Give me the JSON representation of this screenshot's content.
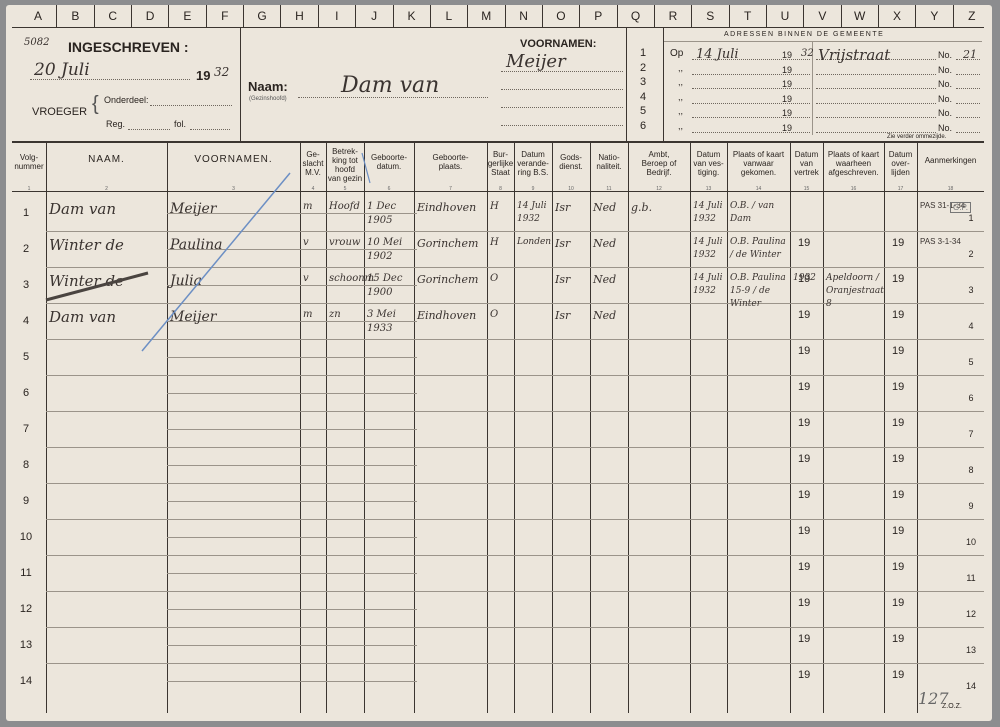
{
  "column_letters": [
    "A",
    "B",
    "C",
    "D",
    "E",
    "F",
    "G",
    "H",
    "I",
    "J",
    "K",
    "L",
    "M",
    "N",
    "O",
    "P",
    "Q",
    "R",
    "S",
    "T",
    "U",
    "V",
    "W",
    "X",
    "Y",
    "Z"
  ],
  "stamp_number": "5082",
  "header": {
    "ingeschreven_label": "INGESCHREVEN :",
    "date_handwritten": "20 Juli",
    "year_printed": "19",
    "year_handwritten": "32",
    "vroeger_label": "VROEGER",
    "onderdeel_label": "Onderdeel:",
    "reg_label": "Reg.",
    "fol_label": "fol.",
    "naam_label": "Naam:",
    "gezinshoofd_label": "(Gezinshoofd)",
    "naam_value": "Dam van",
    "voornamen_label": "VOORNAMEN:",
    "voornamen_value": "Meijer"
  },
  "addresses": {
    "title": "ADRESSEN BINNEN DE GEMEENTE",
    "op_label": "Op",
    "first_date": "14 Juli",
    "year_printed": "19",
    "first_year": "32",
    "first_street": "Vrijstraat",
    "no_label": "No.",
    "first_number": "21",
    "row_numbers": [
      "1",
      "2",
      "3",
      "4",
      "5",
      "6"
    ],
    "quote_mark": ",,",
    "footer_note": "Zie verder ommezijde."
  },
  "table": {
    "columns": [
      {
        "label": "Volg-\nnummer",
        "num": "1"
      },
      {
        "label": "NAAM.",
        "num": "2"
      },
      {
        "label": "VOORNAMEN.",
        "num": "3"
      },
      {
        "label": "Ge-\nslacht\nM.V.",
        "num": "4"
      },
      {
        "label": "Betrek-\nking tot\nhoofd\nvan gezin",
        "num": "5"
      },
      {
        "label": "Geboorte-\ndatum.",
        "num": "6"
      },
      {
        "label": "Geboorte-\nplaats.",
        "num": "7"
      },
      {
        "label": "Bur-\ngerlijke\nStaat",
        "num": "8"
      },
      {
        "label": "Datum\nverande-\nring B.S.",
        "num": "9"
      },
      {
        "label": "Gods-\ndienst.",
        "num": "10"
      },
      {
        "label": "Natio-\nnaliteit.",
        "num": "11"
      },
      {
        "label": "Ambt,\nBeroep of\nBedrijf.",
        "num": "12"
      },
      {
        "label": "Datum\nvan ves-\ntiging.",
        "num": "13"
      },
      {
        "label": "Plaats of kaart\nvanwaar\ngekomen.",
        "num": "14"
      },
      {
        "label": "Datum\nvan\nvertrek",
        "num": "15"
      },
      {
        "label": "Plaats of kaart\nwaarheen\nafgeschreven.",
        "num": "16"
      },
      {
        "label": "Datum\nover-\nlijden",
        "num": "17"
      },
      {
        "label": "Aanmerkingen",
        "num": "18"
      }
    ],
    "row_numbers": [
      "1",
      "2",
      "3",
      "4",
      "5",
      "6",
      "7",
      "8",
      "9",
      "10",
      "11",
      "12",
      "13",
      "14"
    ],
    "printed_year": "19",
    "entries": [
      {
        "naam": "Dam van",
        "voornamen": "Meijer",
        "geslacht": "m",
        "betrekking": "Hoofd",
        "geboortedatum": "1 Dec 1905",
        "geboorteplaats": "Eindhoven",
        "staat": "H",
        "datum_bs": "14 Juli 1932",
        "godsdienst": "Isr",
        "nationaliteit": "Ned",
        "beroep": "g.b.",
        "vestiging": "14 Juli 1932",
        "vanwaar": "O.B. / van Dam",
        "aanmerking": "PAS 31-1-34"
      },
      {
        "naam": "Winter de",
        "voornamen": "Paulina",
        "geslacht": "v",
        "betrekking": "vrouw",
        "geboortedatum": "10 Mei 1902",
        "geboorteplaats": "Gorinchem",
        "staat": "H",
        "datum_bs": "Londen",
        "godsdienst": "Isr",
        "nationaliteit": "Ned",
        "beroep": "",
        "vestiging": "14 Juli 1932",
        "vanwaar": "O.B. Paulina / de Winter",
        "aanmerking": "PAS 3-1-34"
      },
      {
        "naam": "Winter de",
        "voornamen": "Julia",
        "geslacht": "v",
        "betrekking": "schoonm",
        "geboortedatum": "15 Dec 1900",
        "geboorteplaats": "Gorinchem",
        "staat": "O",
        "datum_bs": "",
        "godsdienst": "Isr",
        "nationaliteit": "Ned",
        "beroep": "",
        "vestiging": "14 Juli 1932",
        "vanwaar": "O.B. Paulina 15-9 / de Winter",
        "vertrek": "1932",
        "waarheen": "Apeldoorn / Oranjestraat 8",
        "aanmerking": ""
      },
      {
        "naam": "Dam van",
        "voornamen": "Meijer",
        "geslacht": "m",
        "betrekking": "zn",
        "geboortedatum": "3 Mei 1933",
        "geboorteplaats": "Eindhoven",
        "staat": "O",
        "datum_bs": "",
        "godsdienst": "Isr",
        "nationaliteit": "Ned",
        "beroep": "",
        "vestiging": "",
        "vanwaar": "",
        "aanmerking": ""
      }
    ],
    "stamp": "G.P.",
    "footer_number": "127",
    "zoz": "Z.O.Z."
  },
  "colors": {
    "paper": "#ece6dc",
    "ink": "#3a3330",
    "print": "#2a2420",
    "background": "#8c8d8f",
    "blue_pencil": "#6c8fc4"
  }
}
